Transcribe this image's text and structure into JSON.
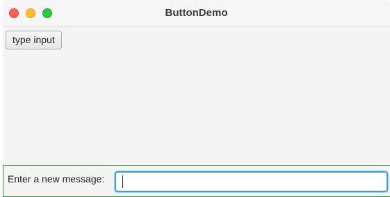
{
  "window": {
    "title": "ButtonDemo"
  },
  "toolbar": {
    "type_input_label": "type input"
  },
  "message_bar": {
    "label": "Enter a new message:",
    "input_value": "",
    "input_placeholder": ""
  },
  "colors": {
    "close": "#fe5f57",
    "minimize": "#febc2e",
    "maximize": "#28c840",
    "focus_ring": "#3b9fe3",
    "panel_border": "#3c8a3c"
  }
}
